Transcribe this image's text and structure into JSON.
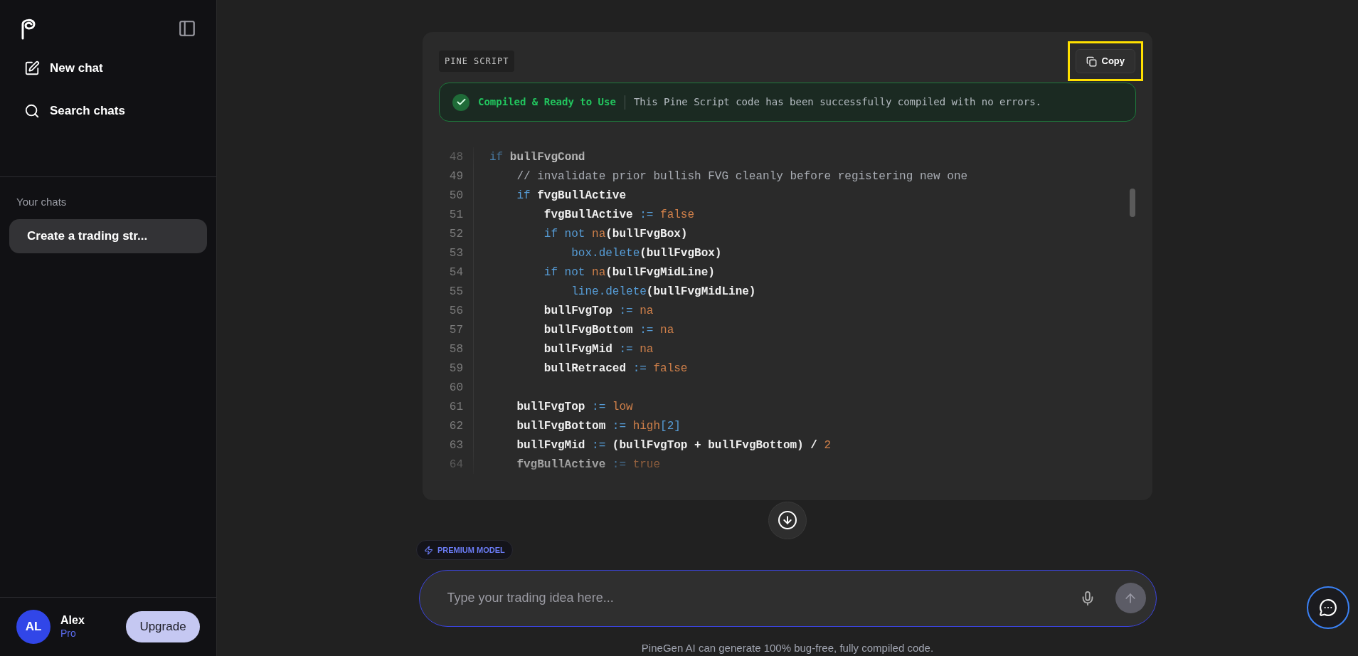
{
  "sidebar": {
    "items": [
      {
        "kind": "new",
        "label": "New chat"
      },
      {
        "kind": "search",
        "label": "Search chats"
      }
    ],
    "section_title": "Your chats",
    "chats": [
      {
        "title": "Create a trading str...",
        "selected": true
      }
    ],
    "user": {
      "initials": "AL",
      "name": "Alex",
      "plan": "Pro",
      "upgrade": "Upgrade"
    }
  },
  "code_block": {
    "language": "PINE SCRIPT",
    "copy": "Copy",
    "copy_highlighted": true,
    "status": {
      "title": "Compiled & Ready to Use",
      "message": "This Pine Script code has been successfully compiled with no errors."
    },
    "lines": [
      {
        "number": "48",
        "tokens": [
          {
            "kind": "kw",
            "text": "if "
          },
          {
            "kind": "id",
            "text": "bullFvgCond"
          }
        ]
      },
      {
        "number": "49",
        "tokens": [
          {
            "kind": "comment",
            "text": "    // invalidate prior bullish FVG cleanly before registering new one"
          }
        ]
      },
      {
        "number": "50",
        "tokens": [
          {
            "kind": "kw",
            "text": "    if "
          },
          {
            "kind": "id",
            "text": "fvgBullActive"
          }
        ]
      },
      {
        "number": "51",
        "tokens": [
          {
            "kind": "id",
            "text": "        fvgBullActive "
          },
          {
            "kind": "op",
            "text": ":= "
          },
          {
            "kind": "lit",
            "text": "false"
          }
        ]
      },
      {
        "number": "52",
        "tokens": [
          {
            "kind": "kw",
            "text": "        if not "
          },
          {
            "kind": "lit",
            "text": "na"
          },
          {
            "kind": "id",
            "text": "(bullFvgBox)"
          }
        ]
      },
      {
        "number": "53",
        "tokens": [
          {
            "kind": "fn",
            "text": "            box.delete"
          },
          {
            "kind": "id",
            "text": "(bullFvgBox)"
          }
        ]
      },
      {
        "number": "54",
        "tokens": [
          {
            "kind": "kw",
            "text": "        if not "
          },
          {
            "kind": "lit",
            "text": "na"
          },
          {
            "kind": "id",
            "text": "(bullFvgMidLine)"
          }
        ]
      },
      {
        "number": "55",
        "tokens": [
          {
            "kind": "fn",
            "text": "            line.delete"
          },
          {
            "kind": "id",
            "text": "(bullFvgMidLine)"
          }
        ]
      },
      {
        "number": "56",
        "tokens": [
          {
            "kind": "id",
            "text": "        bullFvgTop "
          },
          {
            "kind": "op",
            "text": ":= "
          },
          {
            "kind": "lit",
            "text": "na"
          }
        ]
      },
      {
        "number": "57",
        "tokens": [
          {
            "kind": "id",
            "text": "        bullFvgBottom "
          },
          {
            "kind": "op",
            "text": ":= "
          },
          {
            "kind": "lit",
            "text": "na"
          }
        ]
      },
      {
        "number": "58",
        "tokens": [
          {
            "kind": "id",
            "text": "        bullFvgMid "
          },
          {
            "kind": "op",
            "text": ":= "
          },
          {
            "kind": "lit",
            "text": "na"
          }
        ]
      },
      {
        "number": "59",
        "tokens": [
          {
            "kind": "id",
            "text": "        bullRetraced "
          },
          {
            "kind": "op",
            "text": ":= "
          },
          {
            "kind": "lit",
            "text": "false"
          }
        ]
      },
      {
        "number": "60"
      },
      {
        "number": "61",
        "tokens": [
          {
            "kind": "id",
            "text": "    bullFvgTop "
          },
          {
            "kind": "op",
            "text": ":= "
          },
          {
            "kind": "lit",
            "text": "low"
          }
        ]
      },
      {
        "number": "62",
        "tokens": [
          {
            "kind": "id",
            "text": "    bullFvgBottom "
          },
          {
            "kind": "op",
            "text": ":= "
          },
          {
            "kind": "lit",
            "text": "high"
          },
          {
            "kind": "op",
            "text": "[2]"
          }
        ]
      },
      {
        "number": "63",
        "tokens": [
          {
            "kind": "id",
            "text": "    bullFvgMid "
          },
          {
            "kind": "op",
            "text": ":= "
          },
          {
            "kind": "id",
            "text": "(bullFvgTop + bullFvgBottom) / "
          },
          {
            "kind": "lit",
            "text": "2"
          }
        ]
      },
      {
        "number": "64",
        "tokens": [
          {
            "kind": "id",
            "text": "    fvgBullActive "
          },
          {
            "kind": "op",
            "text": ":= "
          },
          {
            "kind": "lit",
            "text": "true"
          }
        ]
      }
    ]
  },
  "model_badge": "PREMIUM MODEL",
  "composer": {
    "placeholder": "Type your trading idea here..."
  },
  "footer": "PineGen AI can generate 100% bug-free, fully compiled code."
}
